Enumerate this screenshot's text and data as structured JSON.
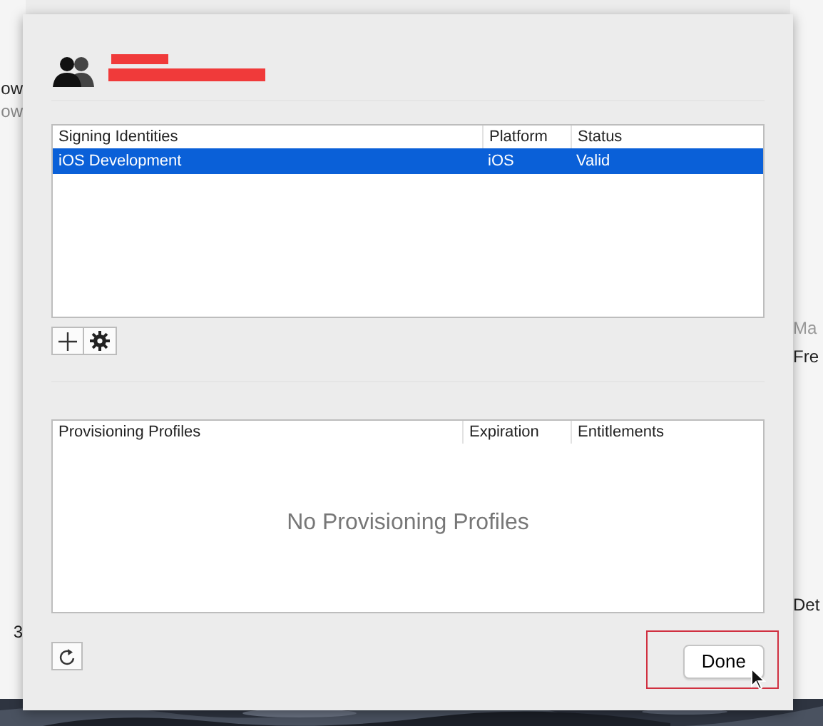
{
  "background_window": {
    "left_texts": [
      "ow",
      "ow",
      "3"
    ],
    "right_texts": [
      "Ma",
      "Fre",
      "Det"
    ]
  },
  "signing_identities": {
    "columns": [
      "Signing Identities",
      "Platform",
      "Status"
    ],
    "rows": [
      {
        "cells": [
          "iOS Development",
          "iOS",
          "Valid"
        ],
        "selected": true
      }
    ]
  },
  "provisioning_profiles": {
    "columns": [
      "Provisioning Profiles",
      "Expiration",
      "Entitlements"
    ],
    "empty_text": "No Provisioning Profiles"
  },
  "done_button": {
    "label": "Done",
    "highlighted": true
  }
}
